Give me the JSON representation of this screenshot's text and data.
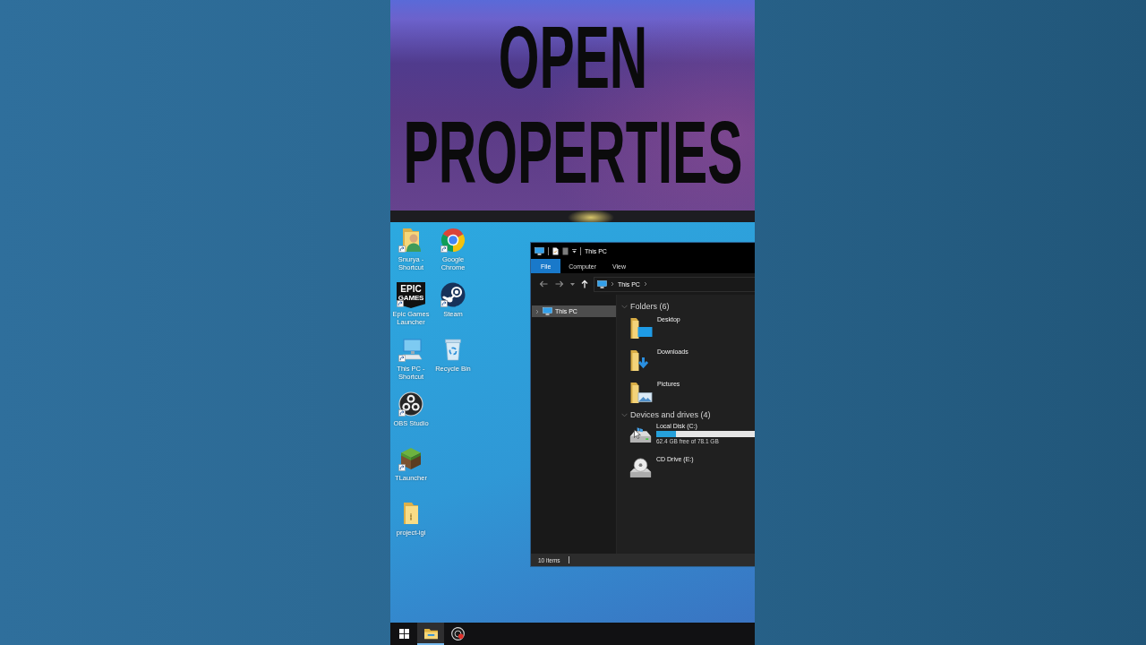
{
  "banner": {
    "title": "OPEN PROPERTIES"
  },
  "desktop_icons": [
    {
      "label": "Snurya - Shortcut",
      "kind": "contact",
      "shortcut": true
    },
    {
      "label": "Epic Games Launcher",
      "kind": "launcher",
      "shortcut": true,
      "logo_text": "EPIC",
      "logo_subtext": "GAMES"
    },
    {
      "label": "This PC - Shortcut",
      "kind": "computer",
      "shortcut": true
    },
    {
      "label": "OBS Studio",
      "kind": "recorder",
      "shortcut": true
    },
    {
      "label": "TLauncher",
      "kind": "block",
      "shortcut": true
    },
    {
      "label": "project-igi",
      "kind": "folder",
      "shortcut": false
    },
    {
      "label": "Google Chrome",
      "kind": "browser",
      "shortcut": true
    },
    {
      "label": "Steam",
      "kind": "game",
      "shortcut": true
    },
    {
      "label": "Recycle Bin",
      "kind": "bin",
      "shortcut": false
    }
  ],
  "explorer": {
    "title": "This PC",
    "ribbon_tabs": [
      {
        "label": "File",
        "selected": true
      },
      {
        "label": "Computer",
        "selected": false
      },
      {
        "label": "View",
        "selected": false
      }
    ],
    "address": {
      "crumbs": [
        "This PC"
      ]
    },
    "nav_pane": [
      {
        "label": "This PC",
        "selected": true,
        "expanded": false
      }
    ],
    "groups": [
      {
        "title": "Folders (6)",
        "expanded": true,
        "items": [
          {
            "label": "Desktop",
            "kind": "desktop"
          },
          {
            "label": "Downloads",
            "kind": "downloads"
          },
          {
            "label": "Pictures",
            "kind": "pictures"
          }
        ]
      },
      {
        "title": "Devices and drives (4)",
        "expanded": true,
        "items": [
          {
            "label": "Local Disk (C:)",
            "kind": "disk",
            "level": 0.2,
            "detail": "62.4 GB free of 78.1 GB"
          },
          {
            "label": "CD Drive (E:)",
            "kind": "cd"
          }
        ]
      }
    ],
    "status": "10 items"
  },
  "taskbar": [
    {
      "kind": "start",
      "active": false
    },
    {
      "kind": "explorer",
      "active": true
    },
    {
      "kind": "recorder",
      "active": false
    }
  ]
}
